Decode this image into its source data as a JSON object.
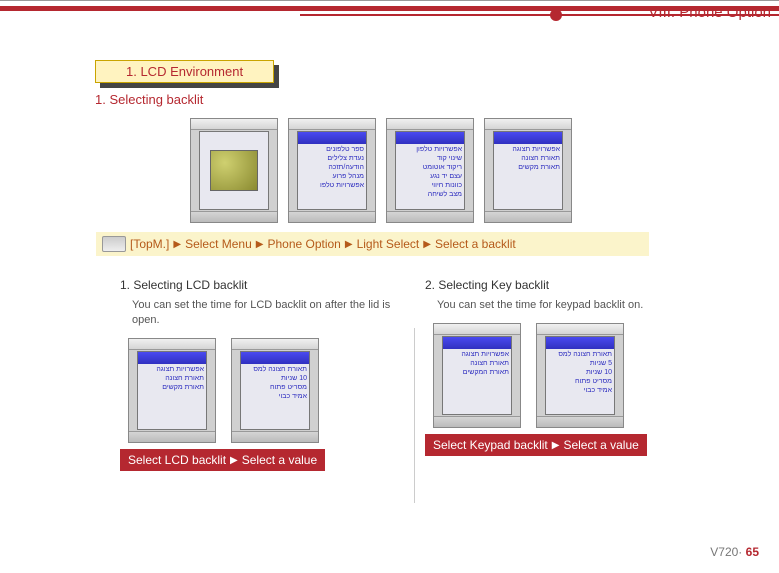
{
  "header": {
    "section": "VIII. Phone Option"
  },
  "yellow": {
    "label": "1. LCD Environment"
  },
  "section_title": "1. Selecting backlit",
  "nav": {
    "parts": [
      "[TopM.]",
      "Select Menu",
      "Phone Option",
      "Light Select",
      "Select a backlit"
    ]
  },
  "left": {
    "title": "1. Selecting LCD backlit",
    "desc": "You can set the time for LCD backlit on after the lid is open.",
    "strip": [
      "Select LCD backlit",
      "Select a value"
    ]
  },
  "right": {
    "title": "2. Selecting Key backlit",
    "desc": "You can set the time for keypad backlit on.",
    "strip": [
      "Select Keypad backlit",
      "Select a value"
    ]
  },
  "footer": {
    "model": "V720·",
    "page": "65"
  }
}
